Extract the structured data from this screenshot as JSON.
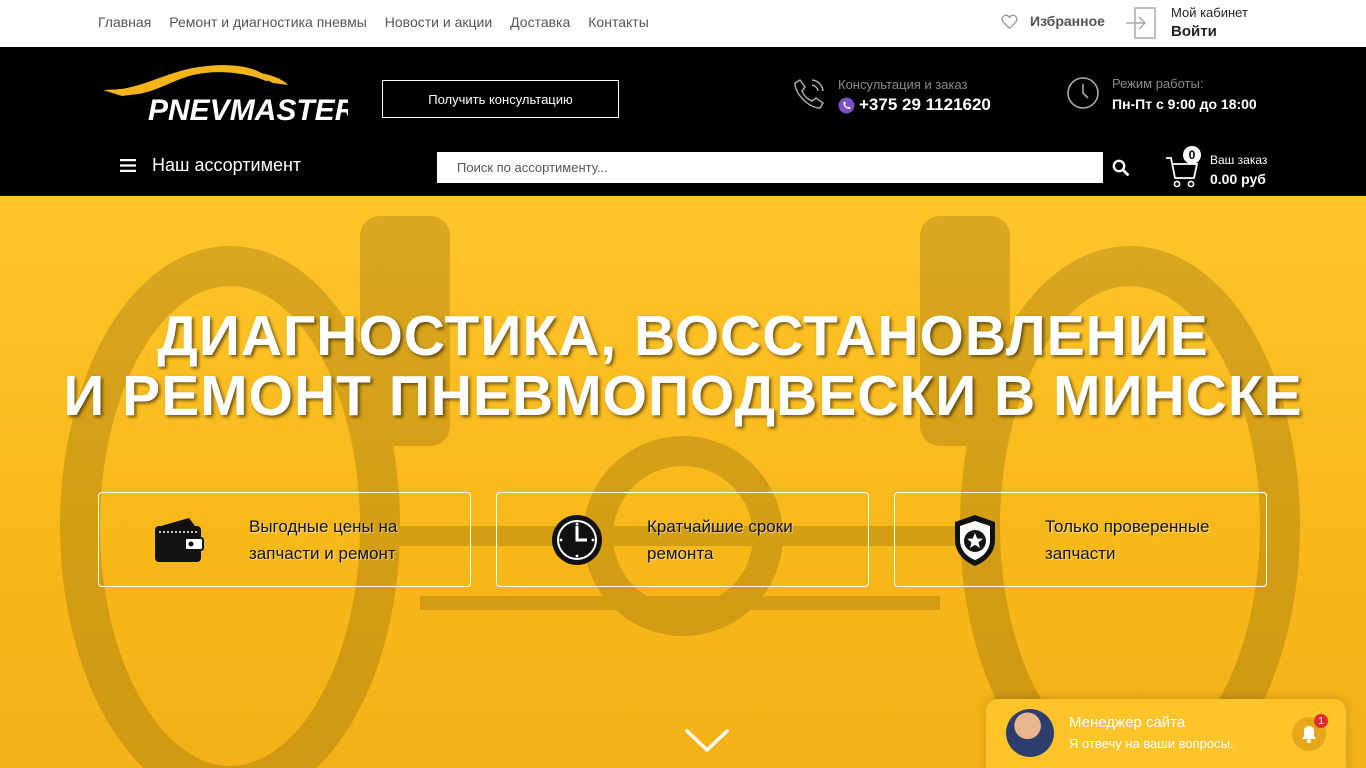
{
  "topnav": {
    "items": [
      {
        "label": "Главная"
      },
      {
        "label": "Ремонт и диагностика пневмы"
      },
      {
        "label": "Новости и акции"
      },
      {
        "label": "Доставка"
      },
      {
        "label": "Контакты"
      }
    ],
    "favorites_label": "Избранное",
    "cabinet_title": "Мой кабинет",
    "login_label": "Войти"
  },
  "header": {
    "logo_text": "PNEVMASTER",
    "consult_button": "Получить консультацию",
    "phone_caption": "Консультация и заказ",
    "phone_number": "+375 29 1121620",
    "hours_caption": "Режим работы:",
    "hours_value": "Пн-Пт с 9:00 до 18:00",
    "assortment_label": "Наш ассортимент",
    "search_placeholder": "Поиск по ассортименту...",
    "cart_count": "0",
    "cart_label": "Ваш заказ",
    "cart_total": "0.00 руб"
  },
  "hero": {
    "title_line1": "ДИАГНОСТИКА, ВОССТАНОВЛЕНИЕ",
    "title_line2": "И РЕМОНТ ПНЕВМОПОДВЕСКИ В МИНСКЕ",
    "features": [
      {
        "icon": "wallet-icon",
        "text": "Выгодные цены на запчасти и ремонт"
      },
      {
        "icon": "clock-icon",
        "text": "Кратчайшие сроки ремонта"
      },
      {
        "icon": "shield-star-icon",
        "text": "Только проверенные запчасти"
      }
    ]
  },
  "chat": {
    "name": "Менеджер сайта",
    "subtitle": "Я отвечу на ваши вопросы.",
    "notification_count": "1"
  },
  "colors": {
    "accent": "#ffc42a",
    "header_bg": "#000000",
    "topbar_bg": "#ffffff"
  }
}
